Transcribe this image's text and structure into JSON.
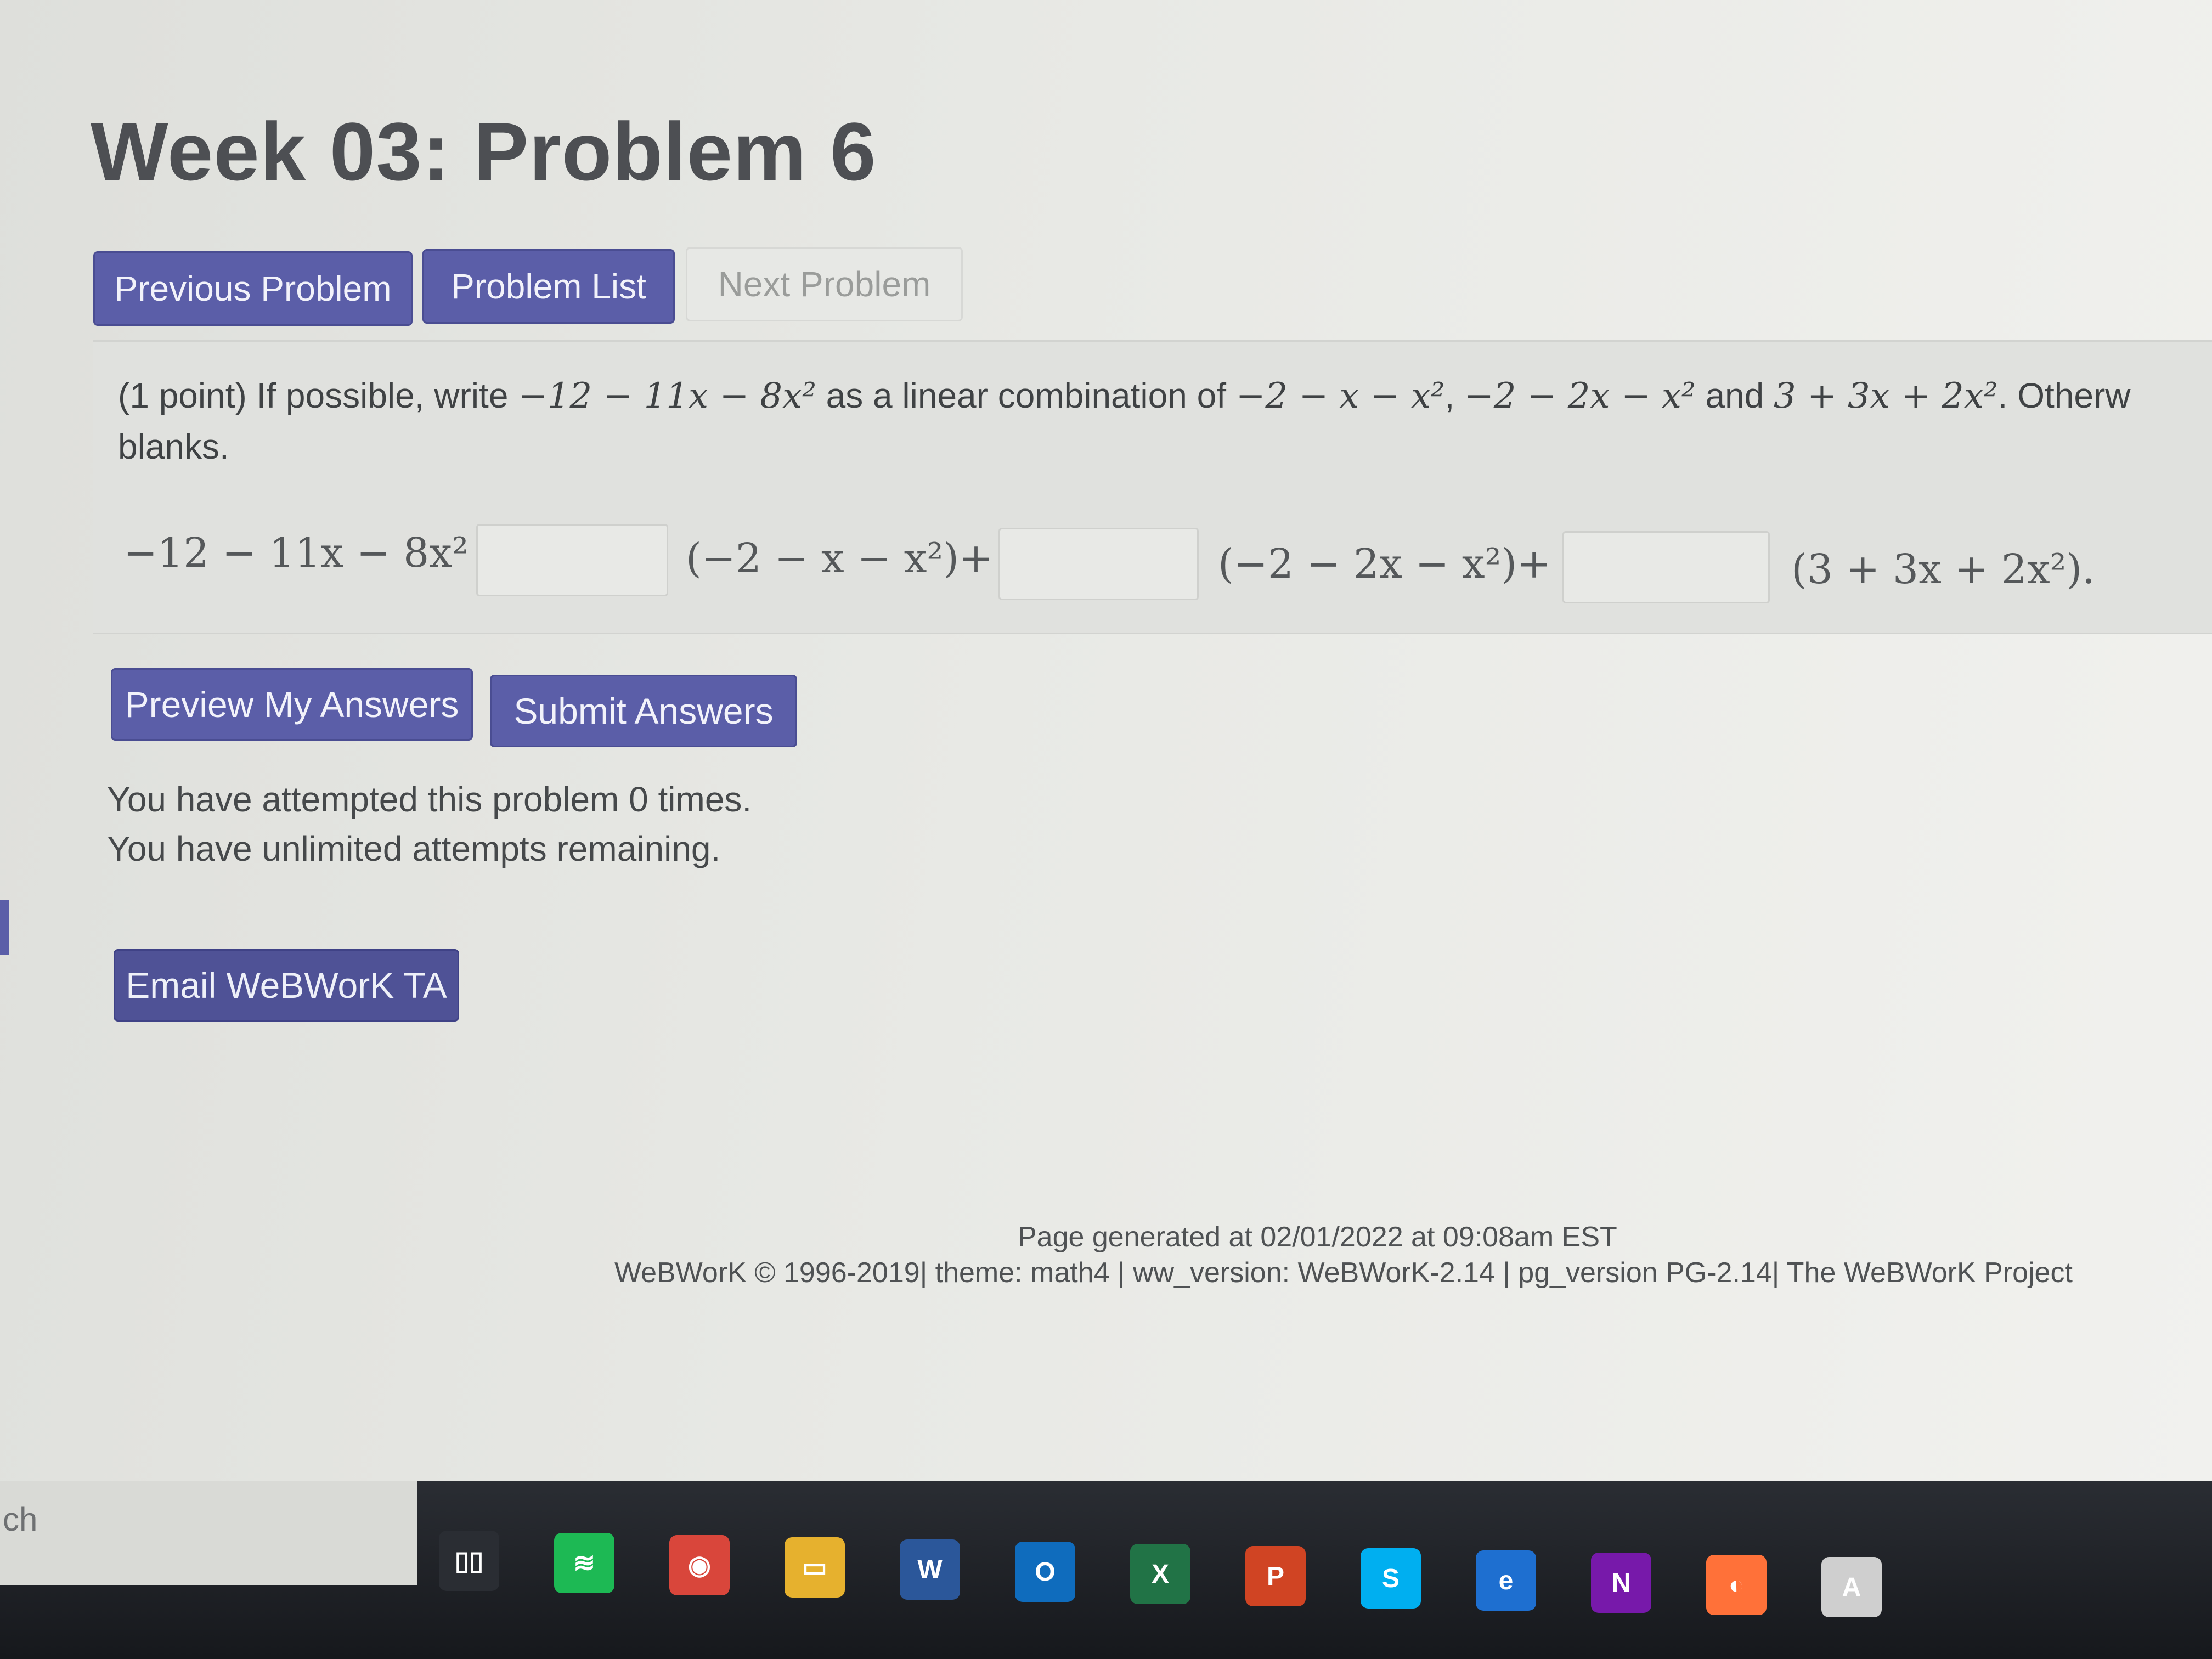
{
  "page": {
    "title": "Week 03: Problem 6"
  },
  "nav": {
    "previous_label": "Previous Problem",
    "list_label": "Problem List",
    "next_label": "Next Problem"
  },
  "problem": {
    "points": "(1 point)",
    "intro": "If possible, write",
    "target": "−12 − 11x − 8x²",
    "mid": "as a linear combination of",
    "p1": "−2 − x − x²",
    "p2": "−2 − 2x − x²",
    "and": "and",
    "p3": "3 + 3x + 2x²",
    "tail": ". Otherw",
    "line2": "blanks.",
    "eq_lhs": "−12 − 11x − 8x² =",
    "term1": "(−2 − x − x²)+",
    "term2": "(−2 − 2x − x²)+",
    "term3": "(3 + 3x + 2x²)."
  },
  "answers": {
    "a1": "",
    "a2": "",
    "a3": ""
  },
  "actions": {
    "preview_label": "Preview My Answers",
    "submit_label": "Submit Answers",
    "email_label": "Email WeBWorK TA"
  },
  "status": {
    "attempted": "You have attempted this problem 0 times.",
    "remaining": "You have unlimited attempts remaining."
  },
  "footer": {
    "generated": "Page generated at 02/01/2022 at 09:08am EST",
    "credits": "WeBWorK © 1996-2019| theme: math4 | ww_version: WeBWorK-2.14 | pg_version PG-2.14| The WeBWorK Project"
  },
  "taskbar": {
    "search_text": "ch",
    "icons": [
      {
        "name": "task-view-icon",
        "glyph": "▯▯",
        "color": "#2a2d33"
      },
      {
        "name": "spotify-icon",
        "glyph": "≋",
        "color": "#1db954"
      },
      {
        "name": "chrome-icon",
        "glyph": "◉",
        "color": "#d9463b"
      },
      {
        "name": "file-explorer-icon",
        "glyph": "▭",
        "color": "#e6b12e"
      },
      {
        "name": "word-icon",
        "glyph": "W",
        "color": "#2b579a"
      },
      {
        "name": "outlook-icon",
        "glyph": "O",
        "color": "#0f6cbd"
      },
      {
        "name": "excel-icon",
        "glyph": "X",
        "color": "#217346"
      },
      {
        "name": "powerpoint-icon",
        "glyph": "P",
        "color": "#d04423"
      },
      {
        "name": "skype-icon",
        "glyph": "S",
        "color": "#00aff0"
      },
      {
        "name": "edge-icon",
        "glyph": "e",
        "color": "#1e6fd0"
      },
      {
        "name": "onenote-icon",
        "glyph": "N",
        "color": "#7719aa"
      },
      {
        "name": "firefox-icon",
        "glyph": "◐",
        "color": "#ff7139"
      },
      {
        "name": "acrobat-icon",
        "glyph": "A",
        "color": "#cfcfcf"
      }
    ]
  }
}
